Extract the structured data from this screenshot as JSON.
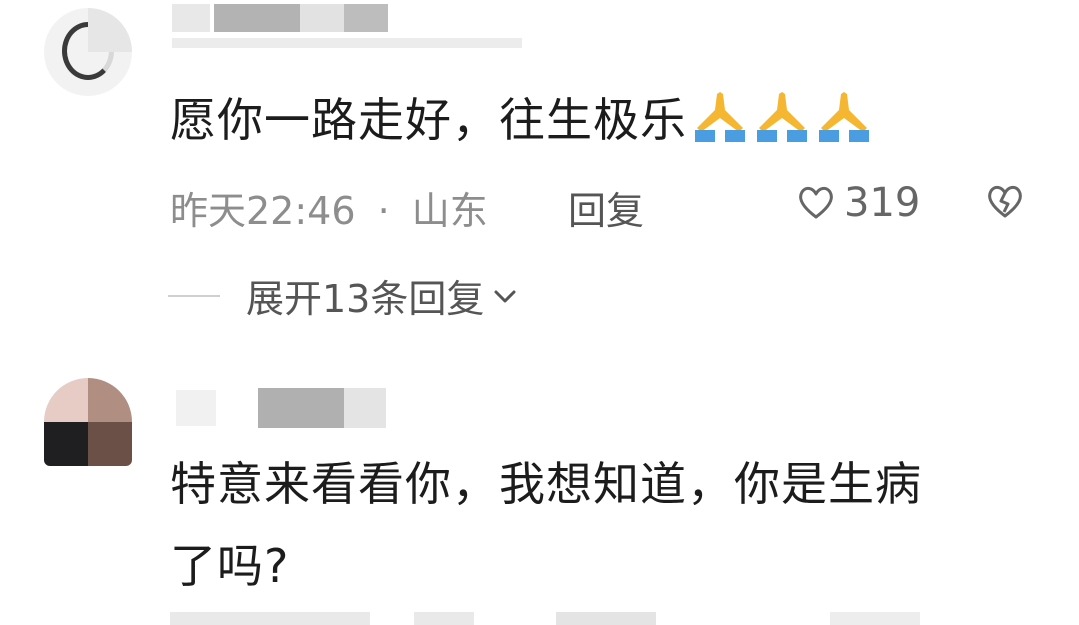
{
  "comments": [
    {
      "text": "愿你一路走好，往生极乐",
      "emoji": "🙏🙏🙏",
      "time": "昨天22:46",
      "separator": "·",
      "location": "山东",
      "reply_label": "回复",
      "likes": "319",
      "expand_label": "展开13条回复"
    },
    {
      "text_line1": "特意来看看你，我想知道，你是生病",
      "text_line2": "了吗?"
    }
  ],
  "icons": {
    "like": "heart-outline-icon",
    "dislike": "broken-heart-icon",
    "expand": "chevron-down-icon",
    "pray": "folded-hands-icon"
  },
  "colors": {
    "text": "#1c1c1c",
    "meta": "#8d8d8d",
    "action": "#555555",
    "pray_skin": "#f5b731",
    "pray_sleeve": "#4a9de0"
  }
}
